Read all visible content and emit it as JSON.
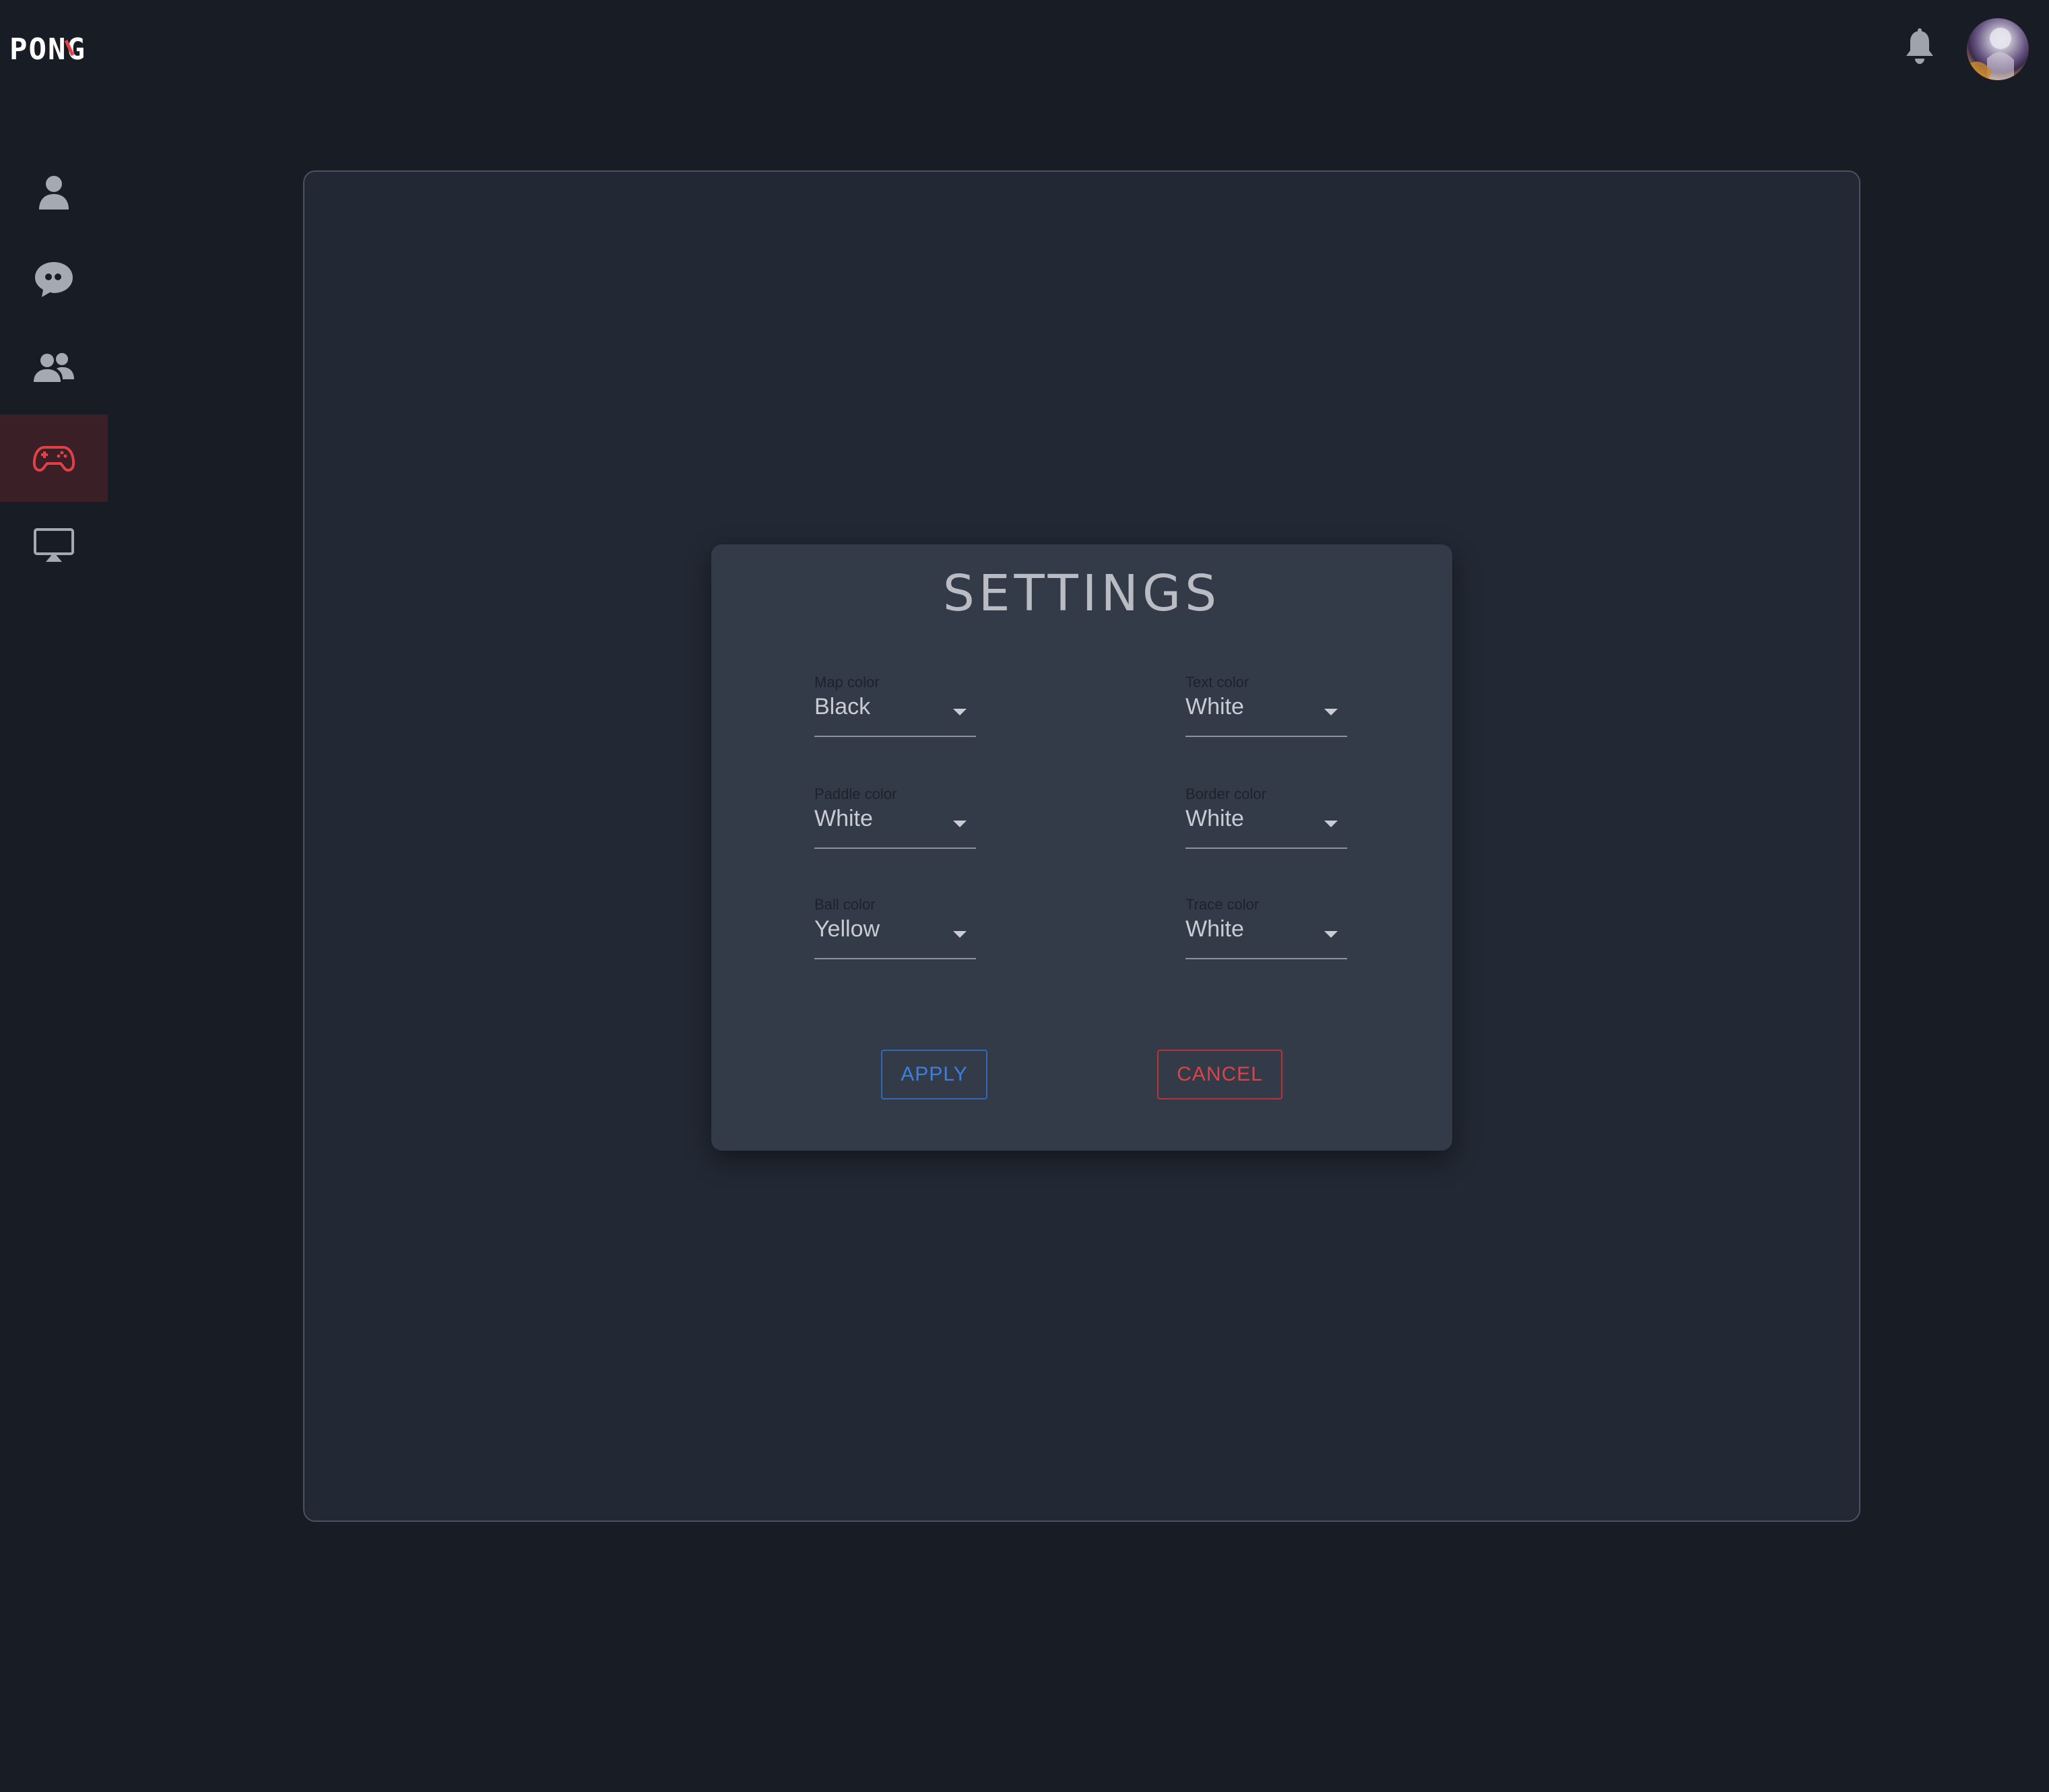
{
  "header": {
    "logo_text": "PONG",
    "icons": {
      "notifications": "bell-icon",
      "avatar": "user-avatar"
    }
  },
  "sidebar": {
    "items": [
      {
        "name": "profile",
        "icon": "user-icon",
        "active": false
      },
      {
        "name": "chat",
        "icon": "chat-bubble-icon",
        "active": false
      },
      {
        "name": "friends",
        "icon": "users-icon",
        "active": false
      },
      {
        "name": "game",
        "icon": "gamepad-icon",
        "active": true
      },
      {
        "name": "watch",
        "icon": "airplay-icon",
        "active": false
      }
    ]
  },
  "settings": {
    "title": "SETTINGS",
    "fields": [
      {
        "label": "Map color",
        "value": "Black"
      },
      {
        "label": "Text color",
        "value": "White"
      },
      {
        "label": "Paddle color",
        "value": "White"
      },
      {
        "label": "Border color",
        "value": "White"
      },
      {
        "label": "Ball color",
        "value": "Yellow"
      },
      {
        "label": "Trace color",
        "value": "White"
      }
    ],
    "apply_label": "APPLY",
    "cancel_label": "CANCEL"
  },
  "colors": {
    "background": "#181d25",
    "panel": "#222934",
    "dialog": "#333b48",
    "accent_red": "#e04046",
    "accent_blue": "#3d7fe0",
    "active_nav_bg": "#3a1f26"
  }
}
